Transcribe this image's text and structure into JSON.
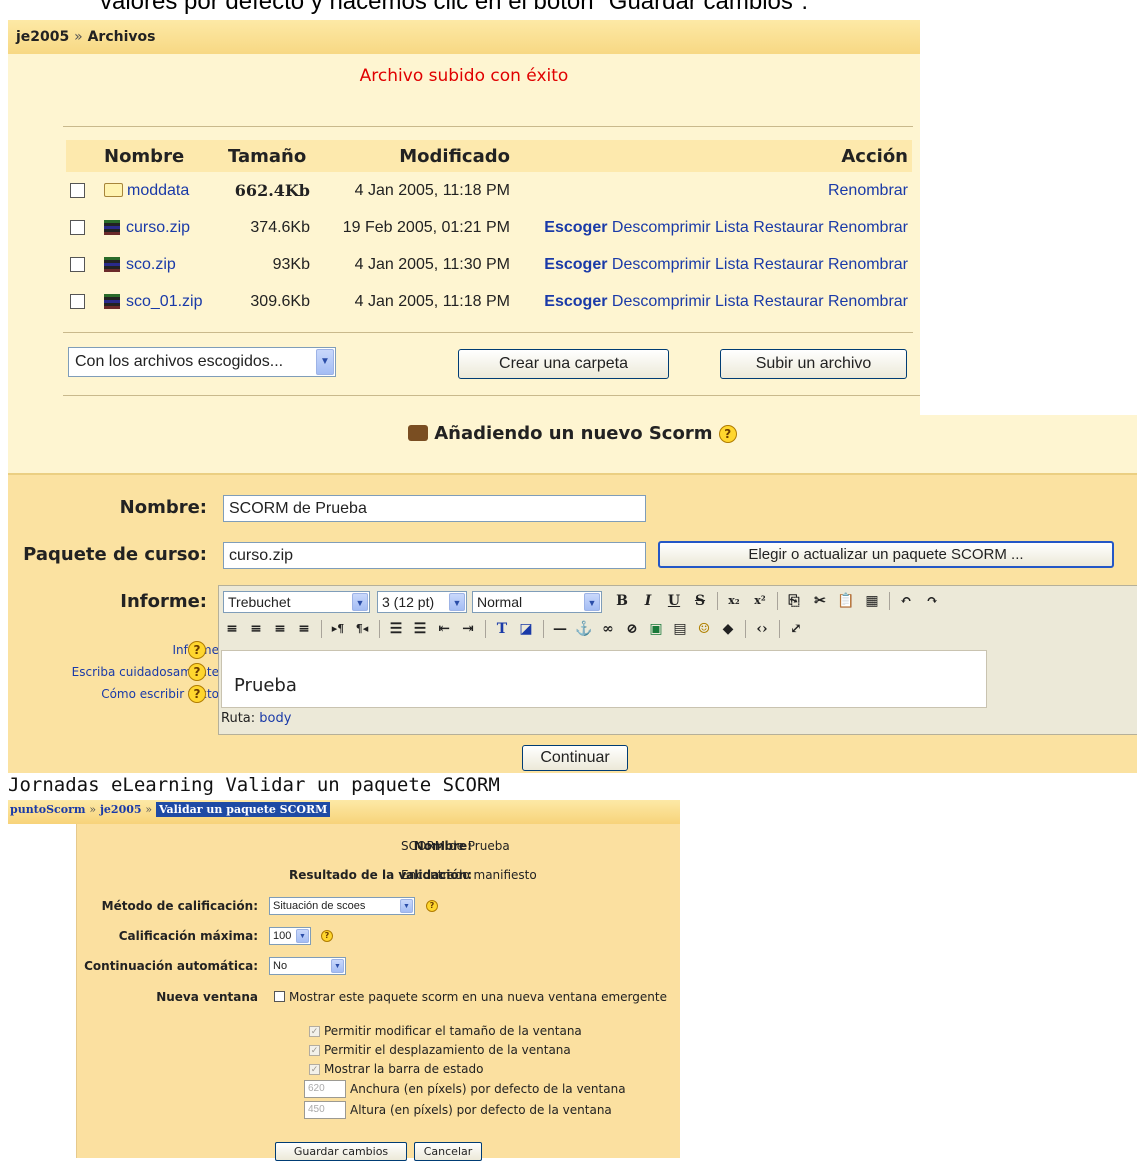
{
  "caption": "valores por defecto y hacemos clic en el botón \"Guardar cambios\".",
  "files": {
    "breadcrumb": {
      "course": "je2005",
      "sep": "»",
      "page": "Archivos"
    },
    "success_message": "Archivo subido con éxito",
    "columns": {
      "name": "Nombre",
      "size": "Tamaño",
      "modified": "Modificado",
      "action": "Acción"
    },
    "rows": [
      {
        "name": "moddata",
        "type": "folder",
        "size": "662.4Kb",
        "modified": "4 Jan 2005, 11:18 PM",
        "actions": {
          "rename": "Renombrar"
        }
      },
      {
        "name": "curso.zip",
        "type": "zip",
        "size": "374.6Kb",
        "modified": "19 Feb 2005, 01:21 PM",
        "actions": {
          "choose": "Escoger",
          "unzip": "Descomprimir",
          "list": "Lista",
          "restore": "Restaurar",
          "rename": "Renombrar"
        }
      },
      {
        "name": "sco.zip",
        "type": "zip",
        "size": "93Kb",
        "modified": "4 Jan 2005, 11:30 PM",
        "actions": {
          "choose": "Escoger",
          "unzip": "Descomprimir",
          "list": "Lista",
          "restore": "Restaurar",
          "rename": "Renombrar"
        }
      },
      {
        "name": "sco_01.zip",
        "type": "zip",
        "size": "309.6Kb",
        "modified": "4 Jan 2005, 11:18 PM",
        "actions": {
          "choose": "Escoger",
          "unzip": "Descomprimir",
          "list": "Lista",
          "restore": "Restaurar",
          "rename": "Renombrar"
        }
      }
    ],
    "with_selected": "Con los archivos escogidos...",
    "create_folder_button": "Crear una carpeta",
    "upload_file_button": "Subir un archivo"
  },
  "scorm": {
    "heading": "Añadiendo un nuevo Scorm",
    "name_label": "Nombre:",
    "name_value": "SCORM de Prueba",
    "package_label": "Paquete de curso:",
    "package_value": "curso.zip",
    "choose_package_button": "Elegir o actualizar un paquete SCORM ...",
    "report_label": "Informe:",
    "font_family": "Trebuchet",
    "font_size": "3 (12 pt)",
    "paragraph_style": "Normal",
    "editor_content": "Prueba",
    "path_label": "Ruta:",
    "path_value": "body",
    "help_links": [
      "Informe",
      "Escriba cuidadosamente",
      "Cómo escribir texto"
    ],
    "continue_button": "Continuar"
  },
  "validate": {
    "title": "Jornadas eLearning Validar un paquete SCORM",
    "breadcrumb": {
      "root": "puntoScorm",
      "course": "je2005",
      "current": "Validar un paquete SCORM",
      "sep": "»"
    },
    "name_label": "Nombre:",
    "name_value": "SCORM de Prueba",
    "result_label": "Resultado de la validación:",
    "result_value": "Encontrado manifiesto",
    "grading_label": "Método de calificación:",
    "grading_value": "Situación de scoes",
    "maxgrade_label": "Calificación máxima:",
    "maxgrade_value": "100",
    "auto_label": "Continuación automática:",
    "auto_value": "No",
    "new_window_label": "Nueva ventana",
    "new_window_text": "Mostrar este paquete scorm en una nueva ventana emergente",
    "options": [
      "Permitir modificar el tamaño de la ventana",
      "Permitir el desplazamiento de la ventana",
      "Mostrar la barra de estado"
    ],
    "width_value": "620",
    "width_label": "Anchura (en píxels) por defecto de la ventana",
    "height_value": "450",
    "height_label": "Altura (en píxels) por defecto de la ventana",
    "save_button": "Guardar cambios",
    "cancel_button": "Cancelar"
  }
}
